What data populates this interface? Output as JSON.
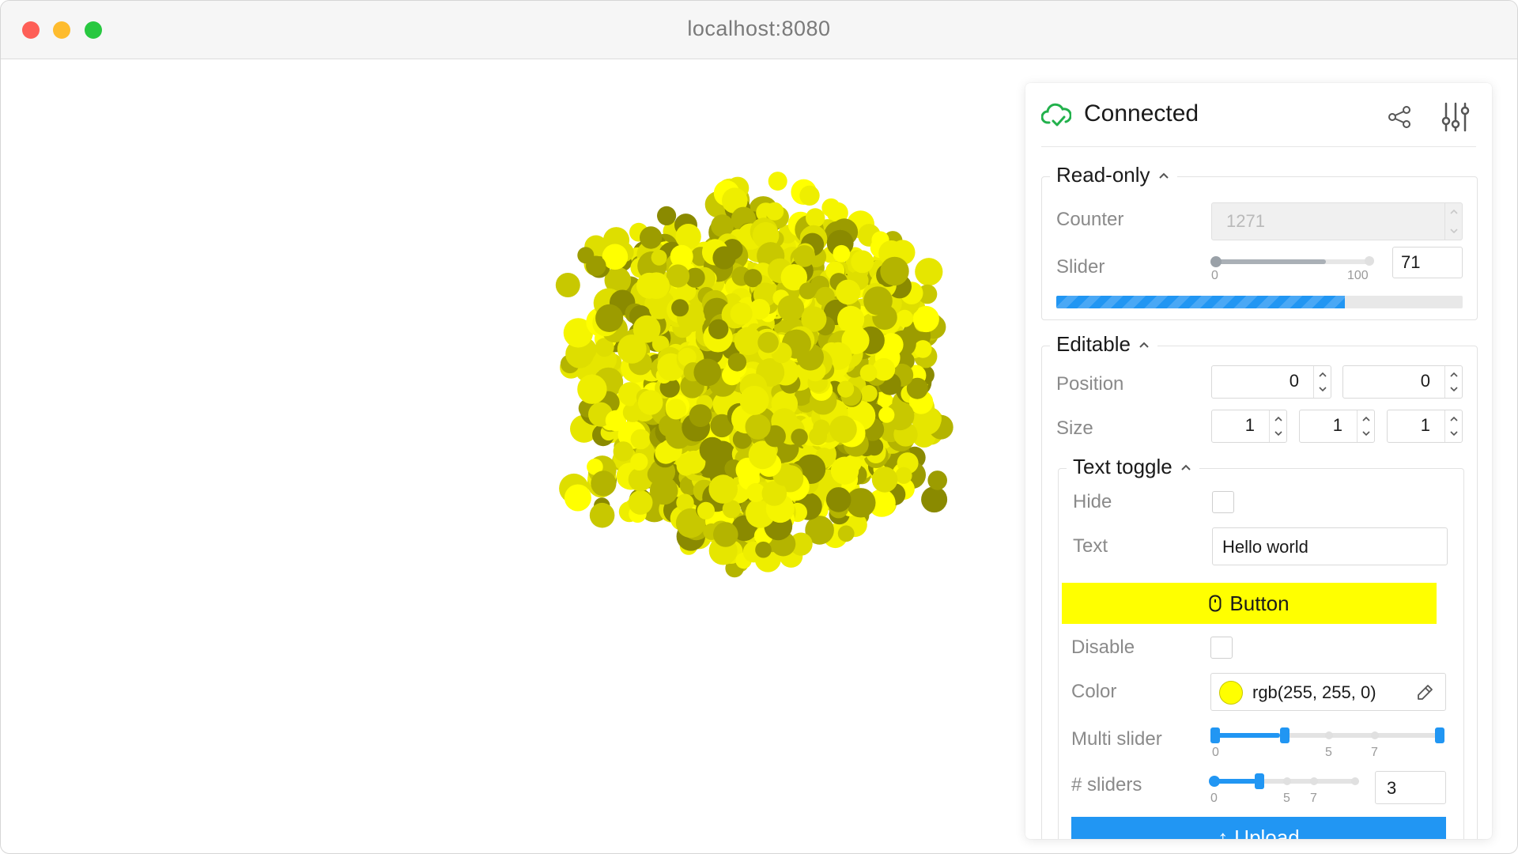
{
  "window": {
    "url": "localhost:8080"
  },
  "scene": {
    "object": "point-cloud cube",
    "color": "#ffff00"
  },
  "panel": {
    "status": "Connected",
    "status_color": "#22b14c",
    "readonly": {
      "title": "Read-only",
      "counter_label": "Counter",
      "counter_value": "1271",
      "slider_label": "Slider",
      "slider_min": "0",
      "slider_max": "100",
      "slider_value": "71",
      "slider_fraction": 0.71
    },
    "editable": {
      "title": "Editable",
      "position_label": "Position",
      "position_x": "0",
      "position_y": "0",
      "size_label": "Size",
      "size_x": "1",
      "size_y": "1",
      "size_z": "1",
      "toggle": {
        "title": "Text toggle",
        "hide_label": "Hide",
        "text_label": "Text",
        "text_value": "Hello world",
        "button_label": "Button",
        "disable_label": "Disable",
        "color_label": "Color",
        "color_value": "rgb(255, 255, 0)",
        "multi_label": "Multi slider",
        "multi_ticks": [
          "0",
          "5",
          "7"
        ],
        "sliders_label": "# sliders",
        "sliders_ticks": [
          "0",
          "5",
          "7"
        ],
        "sliders_value": "3",
        "upload_label": "Upload"
      }
    }
  },
  "colors": {
    "accent": "#2196f3",
    "button_yellow": "#ffff00"
  }
}
